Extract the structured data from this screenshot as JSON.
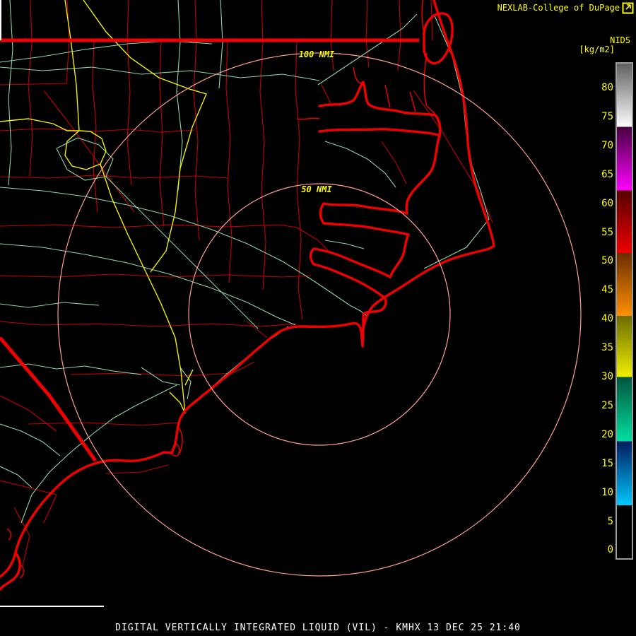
{
  "header": {
    "brand": "NEXLAB-College of DuPage",
    "scale_title": "NIDS",
    "scale_units": "[kg/m2]"
  },
  "colorbar": {
    "ticks": [
      80,
      75,
      70,
      65,
      60,
      55,
      50,
      45,
      40,
      35,
      30,
      25,
      20,
      15,
      10,
      5,
      0
    ],
    "tick_start_y": 124,
    "tick_spacing": 40.9,
    "colors": {
      "gray_dark": "#606060",
      "white": "#ffffff",
      "purple_dark": "#45003f",
      "magenta": "#ff00ff",
      "red_dark": "#550000",
      "red": "#ee0000",
      "brown_dark": "#6b2c00",
      "orange": "#ff9000",
      "olive_dark": "#6b6b00",
      "yellow": "#f0f000",
      "teal_dark": "#00543c",
      "green": "#00e0a0",
      "navy_dark": "#001a5e",
      "cyan": "#00c8ff",
      "black": "#000000"
    }
  },
  "rings": {
    "outer_label": "100 NMI",
    "inner_label": "50 NMI"
  },
  "footer": {
    "title": "DIGITAL VERTICALLY INTEGRATED LIQUID (VIL) - KMHX 13 DEC 25 21:40"
  },
  "map_colors": {
    "coastline": "#f20000",
    "county": "#c40000",
    "road": "#8fd6a5",
    "highway": "#f0f000",
    "range_ring": "#ffa28e"
  }
}
